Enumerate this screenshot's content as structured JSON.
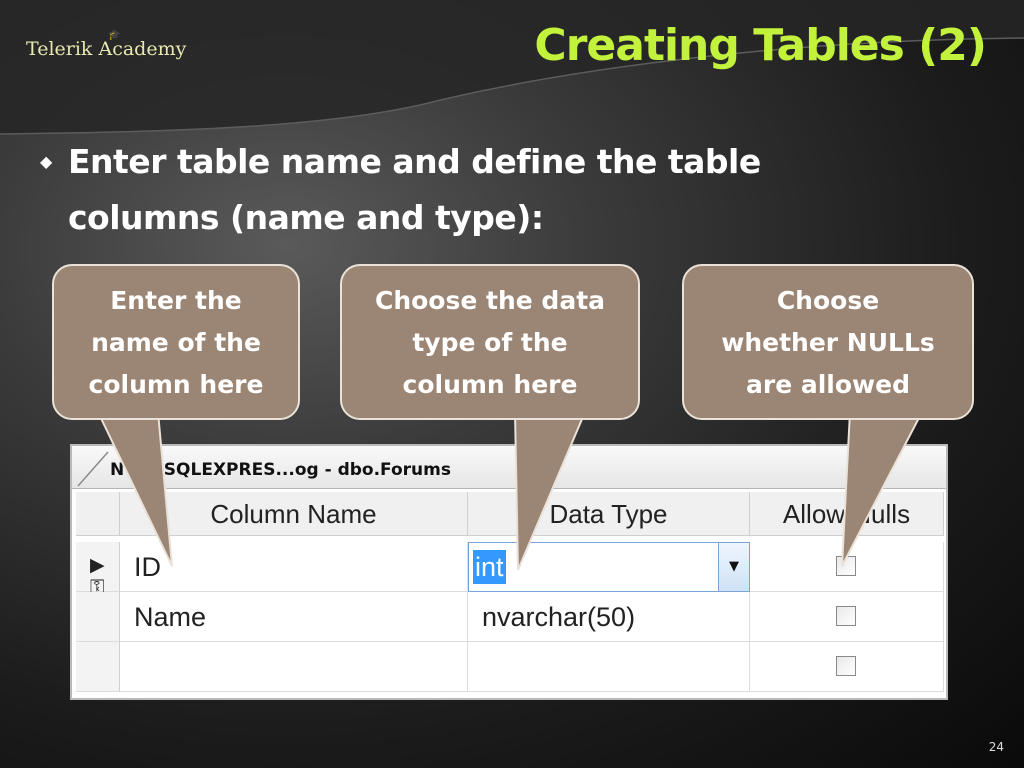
{
  "logo": {
    "text": "Telerik Academy"
  },
  "title": "Creating Tables (2)",
  "bullet": {
    "line1": "Enter table name  and define the table",
    "line2": "columns (name and type):"
  },
  "callouts": {
    "column_name": [
      "Enter the",
      "name of the",
      "column here"
    ],
    "data_type": [
      "Choose the data",
      "type of the",
      "column here"
    ],
    "allow_nulls": [
      "Choose",
      "whether NULLs",
      "are allowed"
    ]
  },
  "designer": {
    "tab_label": "N\\OV\\SQLEXPRES...og - dbo.Forums",
    "headers": {
      "column_name": "Column Name",
      "data_type": "Data Type",
      "allow_nulls": "Allow Nulls"
    },
    "rows": [
      {
        "column_name": "ID",
        "data_type": "int",
        "allow_nulls": false,
        "current": true,
        "primary_key": true
      },
      {
        "column_name": "Name",
        "data_type": "nvarchar(50)",
        "allow_nulls": false
      },
      {
        "column_name": "",
        "data_type": "",
        "allow_nulls": false
      }
    ]
  },
  "slide_number": "24",
  "colors": {
    "title": "#c2f23b",
    "callout_fill": "#9b8574",
    "selection": "#3399ff"
  }
}
